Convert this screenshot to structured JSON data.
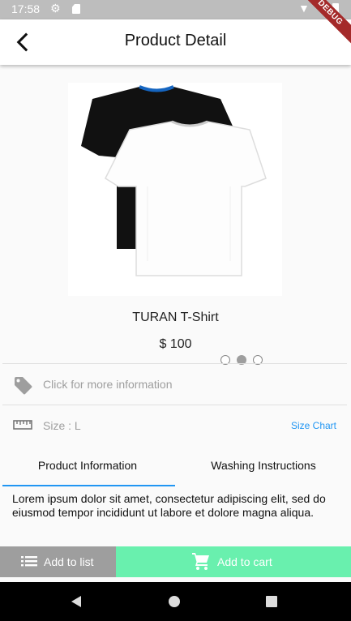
{
  "status_bar": {
    "time": "17:58",
    "icons": [
      "gear-icon",
      "sd-card-icon",
      "wifi-icon",
      "battery-icon"
    ]
  },
  "debug_banner": "DEBUG",
  "app_bar": {
    "title": "Product Detail",
    "back_icon": "back-arrow-icon"
  },
  "product": {
    "name": "TURAN T-Shirt",
    "price": "$ 100",
    "image_icon": "tshirt-image",
    "carousel": {
      "count": 3,
      "active_index": 1
    }
  },
  "info_row": {
    "icon": "tag-icon",
    "text": "Click for more information"
  },
  "size_row": {
    "icon": "ruler-icon",
    "size_text": "Size : L",
    "chart_link": "Size Chart"
  },
  "tabs": [
    {
      "label": "Product Information",
      "selected": true
    },
    {
      "label": "Washing Instructions",
      "selected": false
    }
  ],
  "description": "Lorem ipsum dolor sit amet, consectetur adipiscing elit, sed do eiusmod tempor incididunt ut labore et dolore magna aliqua.",
  "actions": {
    "add_to_list": {
      "label": "Add to list",
      "icon": "list-icon"
    },
    "add_to_cart": {
      "label": "Add to cart",
      "icon": "cart-icon"
    }
  },
  "colors": {
    "accent": "#2196f3",
    "cart_button": "#69f0ae",
    "list_button": "#9e9e9e",
    "debug_banner": "#a42a2a"
  },
  "nav_bar": [
    "back-nav-icon",
    "home-nav-icon",
    "recents-nav-icon"
  ]
}
